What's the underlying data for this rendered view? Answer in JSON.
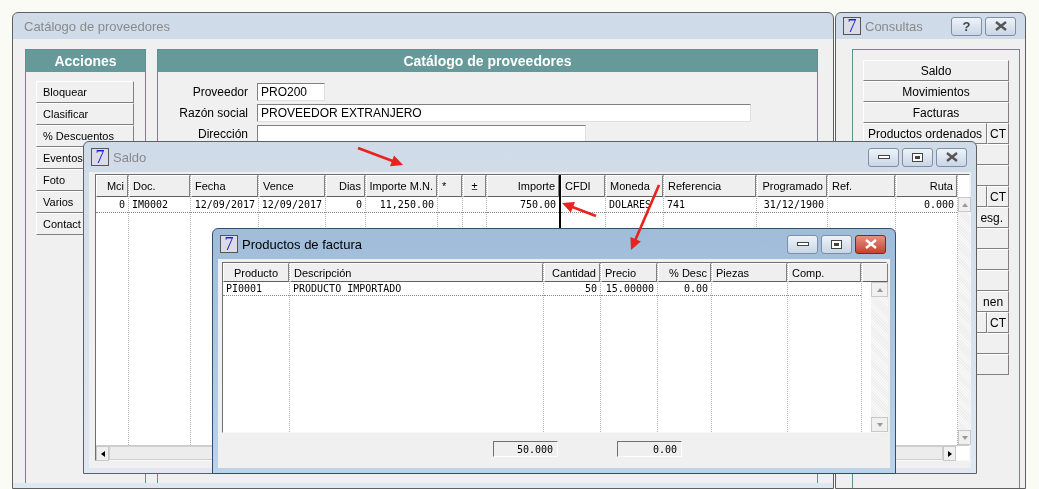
{
  "main_window": {
    "title": "Catálogo de proveedores",
    "active": false,
    "actions_panel": {
      "title": "Acciones",
      "buttons": [
        "Bloquear",
        "Clasificar",
        "% Descuentos",
        "Eventos",
        "Foto",
        "Varios",
        "Contact"
      ]
    },
    "catalog_panel": {
      "title": "Catálogo de proveedores",
      "fields": [
        {
          "label": "Proveedor",
          "value": "PRO200"
        },
        {
          "label": "Razón social",
          "value": "PROVEEDOR EXTRANJERO"
        },
        {
          "label": "Dirección"
        }
      ]
    }
  },
  "consultas_window": {
    "logo": "7",
    "title": "Consultas",
    "active": false,
    "help_button": "?",
    "rows": [
      {
        "kind": "full",
        "label": "Saldo"
      },
      {
        "kind": "full",
        "label": "Movimientos"
      },
      {
        "kind": "full",
        "label": "Facturas"
      },
      {
        "kind": "full",
        "label": "Productos ordenados",
        "ct": "CT"
      },
      {
        "kind": "partial"
      },
      {
        "kind": "partial"
      },
      {
        "kind": "partial",
        "ct": "CT"
      },
      {
        "kind": "partial",
        "label": "esg."
      },
      {
        "kind": "partial"
      },
      {
        "kind": "partial"
      },
      {
        "kind": "partial"
      },
      {
        "kind": "partial",
        "label": "nen"
      },
      {
        "kind": "partial",
        "ct": "CT"
      },
      {
        "kind": "partial"
      },
      {
        "kind": "partial"
      }
    ]
  },
  "saldo_window": {
    "logo": "7",
    "title": "Saldo",
    "active": false,
    "columns": [
      "Mci",
      "Doc.",
      "Fecha",
      "Vence",
      "Dias",
      "Importe M.N.",
      "*",
      "±",
      "Importe",
      "CFDI",
      "Moneda",
      "Referencia",
      "Programado",
      "Ref.",
      "Ruta"
    ],
    "rows": [
      [
        "0",
        "IM0002",
        "12/09/2017",
        "12/09/2017",
        "0",
        "11,250.00",
        null,
        null,
        "750.00",
        null,
        "DOLARES",
        "741",
        "31/12/1900",
        null,
        "0.000"
      ]
    ]
  },
  "productos_window": {
    "logo": "7",
    "title": "Productos de factura",
    "active": true,
    "columns": [
      "Producto",
      "Descripción",
      "Cantidad",
      "Precio",
      "% Desc",
      "Piezas",
      "Comp."
    ],
    "rows": [
      [
        "PI0001",
        "PRODUCTO IMPORTADO",
        "50",
        "15.00000",
        "0.00",
        null,
        null
      ]
    ],
    "totals": [
      "50.000",
      "0.00"
    ]
  }
}
